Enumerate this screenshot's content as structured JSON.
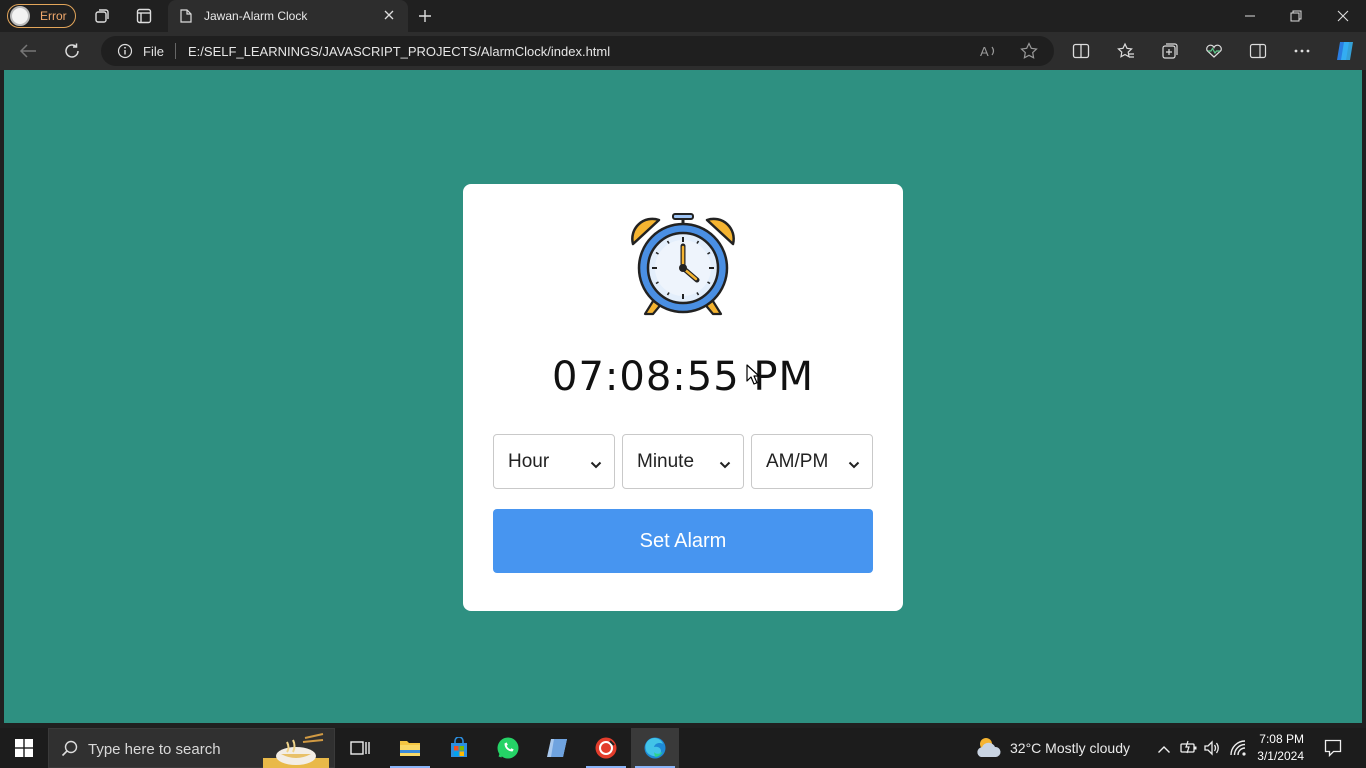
{
  "browser": {
    "profile_label": "Error",
    "tab_title": "Jawan-Alarm Clock",
    "address_scheme": "File",
    "address_url": "E:/SELF_LEARNINGS/JAVASCRIPT_PROJECTS/AlarmClock/index.html"
  },
  "page": {
    "time": "07:08:55 PM",
    "hour_select": "Hour",
    "minute_select": "Minute",
    "ampm_select": "AM/PM",
    "set_alarm_label": "Set Alarm"
  },
  "taskbar": {
    "search_placeholder": "Type here to search",
    "weather": "32°C  Mostly cloudy",
    "clock_time": "7:08 PM",
    "clock_date": "3/1/2024"
  },
  "colors": {
    "page_bg": "#2e9081",
    "button": "#4795f0",
    "card": "#ffffff"
  }
}
